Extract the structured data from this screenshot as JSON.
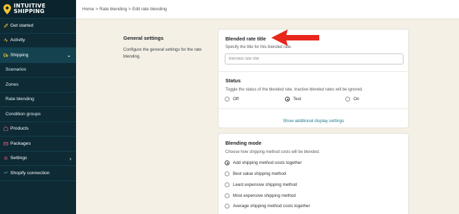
{
  "app": {
    "logo_line1": "INTUITIVE",
    "logo_line2": "SHIPPING"
  },
  "sidebar": {
    "items": [
      {
        "label": "Get started",
        "icon": "rocket-icon"
      },
      {
        "label": "Activity",
        "icon": "activity-icon"
      },
      {
        "label": "Shipping",
        "icon": "truck-icon",
        "expanded": true
      },
      {
        "label": "Scenarios"
      },
      {
        "label": "Zones"
      },
      {
        "label": "Rate blending"
      },
      {
        "label": "Condition groups"
      },
      {
        "label": "Products",
        "icon": "products-icon"
      },
      {
        "label": "Packages",
        "icon": "packages-icon"
      },
      {
        "label": "Settings",
        "icon": "gear-icon"
      },
      {
        "label": "Shopify connection",
        "icon": "connection-icon"
      }
    ]
  },
  "breadcrumb": {
    "home": "Home",
    "sep": ">",
    "section": "Rate blending",
    "page": "Edit rate blending"
  },
  "general": {
    "title": "General settings",
    "description": "Configure the general settings for the rate blending."
  },
  "blended_rate_title": {
    "label": "Blended rate title",
    "help": "Specify the title for this blended rate.",
    "value": "",
    "placeholder": "blended rate title"
  },
  "status": {
    "label": "Status",
    "help": "Toggle the status of the blended rate. Inactive blended rates will be ignored.",
    "options": [
      "Off",
      "Test",
      "On"
    ],
    "selected": "Test"
  },
  "show_additional_link": "Show additional display settings",
  "blending_mode": {
    "label": "Blending mode",
    "help": "Choose how shipping method costs will be blended.",
    "options": [
      "Add shipping method costs together",
      "Best value shipping method",
      "Least expensive shipping method",
      "Most expensive shipping method",
      "Average shipping method costs together"
    ],
    "selected": "Add shipping method costs together"
  },
  "colors": {
    "sidebar": "#0d2a35",
    "accent": "#1f7a8c",
    "arrow": "#e8261c",
    "background": "#f5f0e6"
  }
}
